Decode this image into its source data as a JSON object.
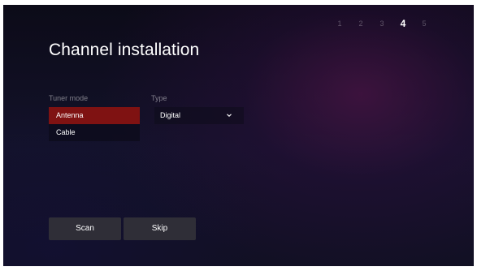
{
  "steps": [
    "1",
    "2",
    "3",
    "4",
    "5"
  ],
  "active_step": "4",
  "page_title": "Channel installation",
  "tuner_mode": {
    "label": "Tuner mode",
    "options": [
      "Antenna",
      "Cable"
    ],
    "selected": "Antenna"
  },
  "type": {
    "label": "Type",
    "value": "Digital"
  },
  "buttons": {
    "scan_label": "Scan",
    "skip_label": "Skip"
  },
  "colors": {
    "selected_option": "#7f1212",
    "button_bg": "#2f2e37",
    "background": "#13122a"
  },
  "icons": {
    "type_dropdown": "chevron-down-icon"
  }
}
